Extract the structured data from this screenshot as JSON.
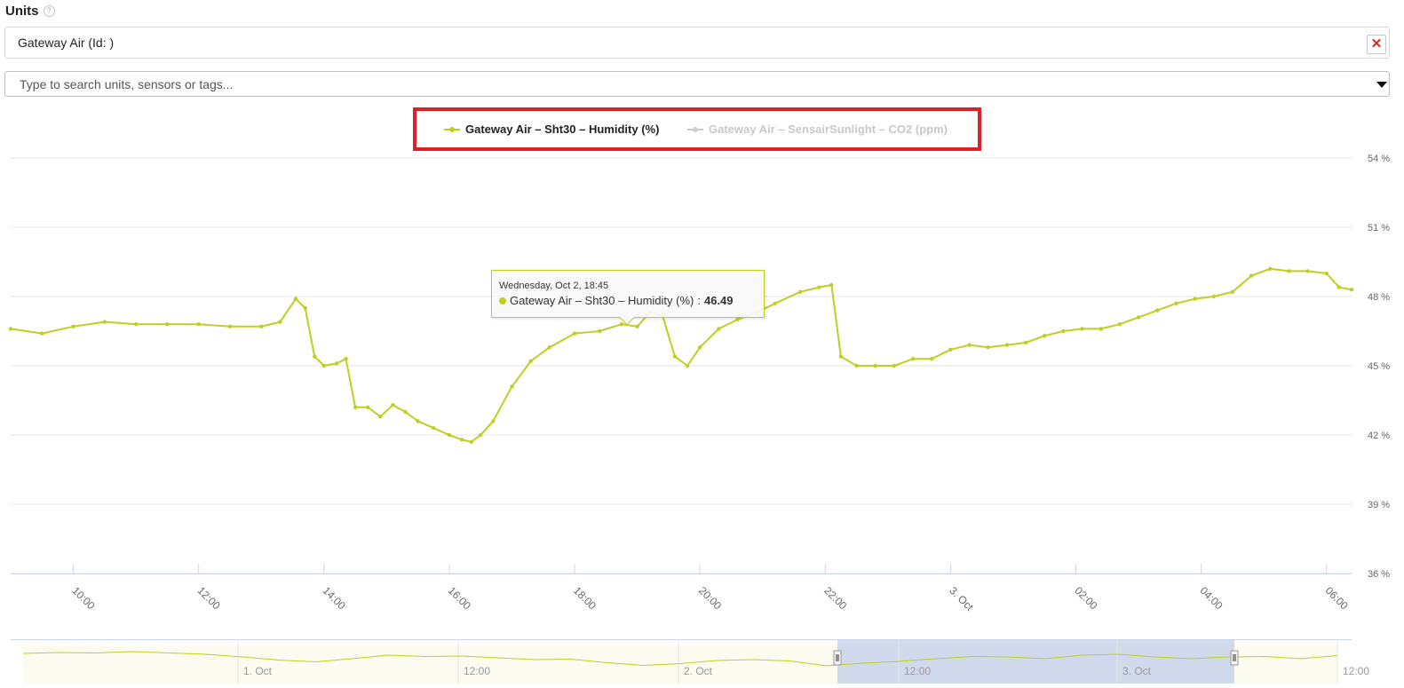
{
  "units": {
    "title": "Units",
    "help_icon": "?",
    "selected_unit": "Gateway Air (Id:            )",
    "remove_icon": "✕"
  },
  "search": {
    "placeholder": "Type to search units, sensors or tags..."
  },
  "legend": {
    "items": [
      {
        "label": "Gateway Air – Sht30 – Humidity (%)",
        "visible": true,
        "color": "#bfcf22"
      },
      {
        "label": "Gateway Air – SensairSunlight – CO2 (ppm)",
        "visible": false,
        "color": "#cccccc"
      }
    ],
    "highlight_color": "#d9222a"
  },
  "tooltip": {
    "date": "Wednesday, Oct 2, 18:45",
    "series": "Gateway Air – Sht30 – Humidity (%)",
    "value": "46.49"
  },
  "chart_data": {
    "type": "line",
    "series": [
      {
        "name": "Gateway Air – Sht30 – Humidity (%)",
        "color": "#bfcf22",
        "x_hours": [
          9.0,
          9.5,
          10.0,
          10.5,
          11.0,
          11.5,
          12.0,
          12.5,
          13.0,
          13.3,
          13.55,
          13.7,
          13.85,
          14.0,
          14.2,
          14.35,
          14.5,
          14.7,
          14.9,
          15.1,
          15.3,
          15.5,
          15.75,
          16.0,
          16.2,
          16.35,
          16.5,
          16.7,
          17.0,
          17.3,
          17.6,
          18.0,
          18.4,
          18.75,
          19.0,
          19.2,
          19.4,
          19.6,
          19.8,
          20.0,
          20.3,
          20.6,
          20.9,
          21.2,
          21.6,
          21.9,
          22.1,
          22.25,
          22.5,
          22.8,
          23.1,
          23.4,
          23.7,
          24.0,
          24.3,
          24.6,
          24.9,
          25.2,
          25.5,
          25.8,
          26.1,
          26.4,
          26.7,
          27.0,
          27.3,
          27.6,
          27.9,
          28.2,
          28.5,
          28.8,
          29.1,
          29.4,
          29.7,
          30.0,
          30.2,
          30.4
        ],
        "values": [
          46.6,
          46.4,
          46.7,
          46.9,
          46.8,
          46.8,
          46.8,
          46.7,
          46.7,
          46.9,
          47.9,
          47.5,
          45.4,
          45.0,
          45.1,
          45.3,
          43.2,
          43.2,
          42.8,
          43.3,
          43.0,
          42.6,
          42.3,
          42.0,
          41.8,
          41.7,
          42.0,
          42.6,
          44.1,
          45.2,
          45.8,
          46.4,
          46.5,
          46.8,
          46.7,
          47.3,
          47.2,
          45.4,
          45.0,
          45.8,
          46.6,
          47.0,
          47.3,
          47.7,
          48.2,
          48.4,
          48.5,
          45.4,
          45.0,
          45.0,
          45.0,
          45.3,
          45.3,
          45.7,
          45.9,
          45.8,
          45.9,
          46.0,
          46.3,
          46.5,
          46.6,
          46.6,
          46.8,
          47.1,
          47.4,
          47.7,
          47.9,
          48.0,
          48.2,
          48.9,
          49.2,
          49.1,
          49.1,
          49.0,
          48.4,
          48.3
        ]
      },
      {
        "name": "Gateway Air – SensairSunlight – CO2 (ppm)",
        "color": "#cccccc",
        "visible": false,
        "values": []
      }
    ],
    "ylim": [
      36,
      54
    ],
    "yticks": [
      36,
      39,
      42,
      45,
      48,
      51,
      54
    ],
    "ytick_labels": [
      "36 %",
      "39 %",
      "42 %",
      "45 %",
      "48 %",
      "51 %",
      "54 %"
    ],
    "xlim_hours": [
      9.0,
      30.4
    ],
    "xticks_hours": [
      10,
      12,
      14,
      16,
      18,
      20,
      22,
      24,
      26,
      28,
      30
    ],
    "xtick_labels": [
      "10:00",
      "12:00",
      "14:00",
      "16:00",
      "18:00",
      "20:00",
      "22:00",
      "3. Oct",
      "02:00",
      "04:00",
      "06:00"
    ],
    "grid": true,
    "navigator": {
      "labels": [
        "1. Oct",
        "12:00",
        "2. Oct",
        "12:00",
        "3. Oct",
        "12:00"
      ],
      "selection_fill": "#ccd6eb"
    }
  }
}
